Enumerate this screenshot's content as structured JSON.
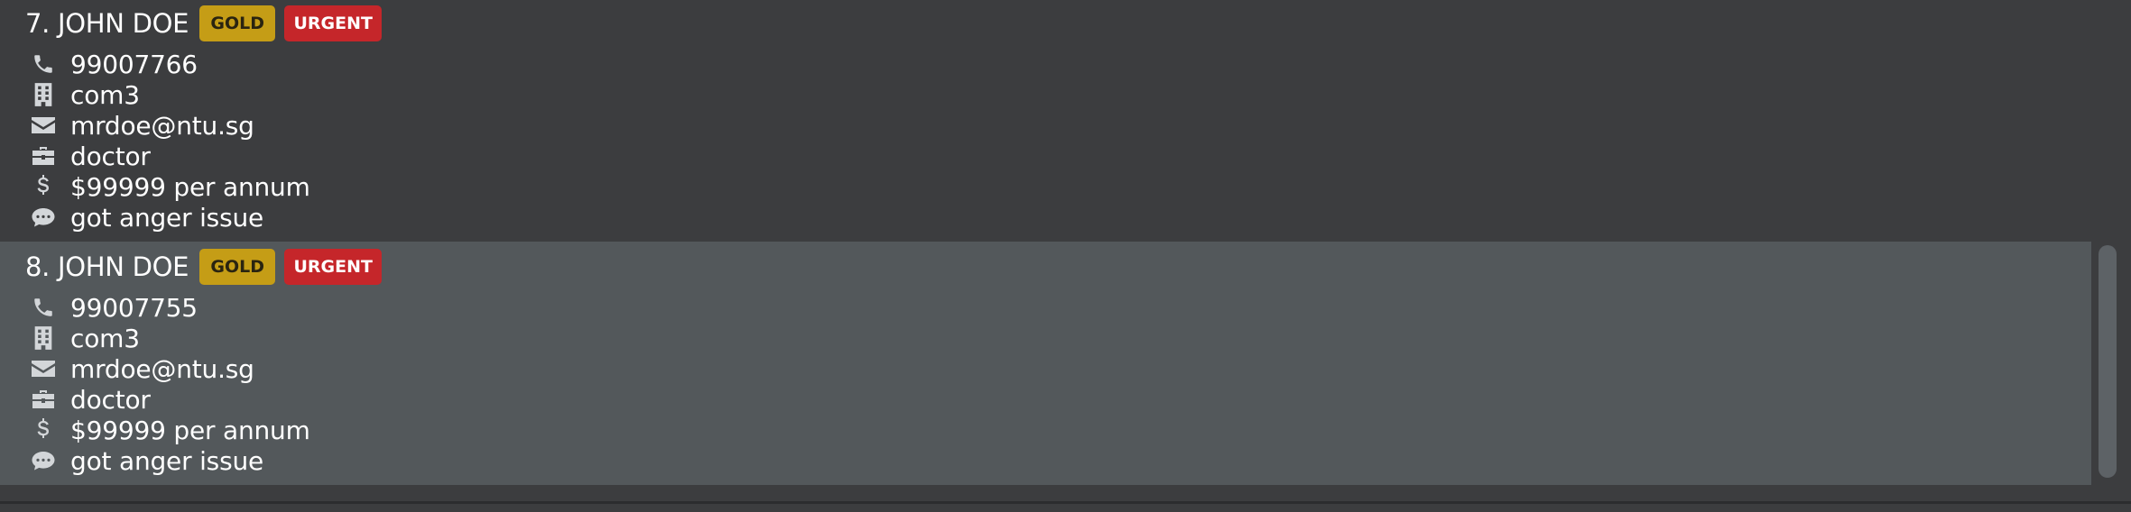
{
  "persons": [
    {
      "index": "7.",
      "name": "JOHN DOE",
      "tags": [
        "GOLD",
        "URGENT"
      ],
      "phone": "99007766",
      "address": "com3",
      "email": "mrdoe@ntu.sg",
      "occupation": "doctor",
      "income": "$99999 per annum",
      "remark": "got anger issue"
    },
    {
      "index": "8.",
      "name": "JOHN DOE",
      "tags": [
        "GOLD",
        "URGENT"
      ],
      "phone": "99007755",
      "address": "com3",
      "email": "mrdoe@ntu.sg",
      "occupation": "doctor",
      "income": "$99999 per annum",
      "remark": "got anger issue"
    }
  ],
  "icons": {
    "phone": "phone-icon",
    "address": "building-icon",
    "email": "envelope-icon",
    "occupation": "briefcase-icon",
    "income": "dollar-icon",
    "remark": "comment-icon"
  },
  "colors": {
    "card_odd": "#3c3d3f",
    "card_even": "#53585b",
    "tag_gold": "#c59d16",
    "tag_urgent": "#c5262a",
    "text": "#ffffff",
    "icon": "#d3d6d9"
  }
}
